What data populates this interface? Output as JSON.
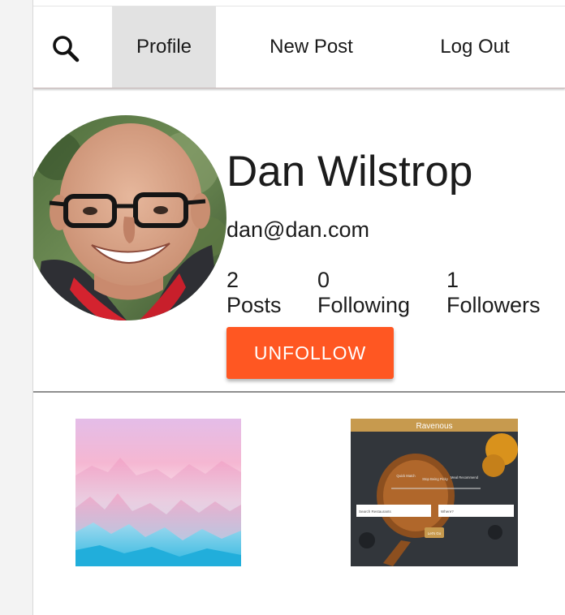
{
  "nav": {
    "search_icon": "search-icon",
    "items": [
      {
        "label": "Profile",
        "active": true
      },
      {
        "label": "New Post",
        "active": false
      },
      {
        "label": "Log Out",
        "active": false
      }
    ]
  },
  "profile": {
    "name": "Dan Wilstrop",
    "email": "dan@dan.com",
    "stats": [
      {
        "count": "2",
        "label": "Posts"
      },
      {
        "count": "0",
        "label": "Following"
      },
      {
        "count": "1",
        "label": "Followers"
      }
    ],
    "action_label": "UNFOLLOW"
  },
  "posts": [
    {
      "title": ""
    },
    {
      "title": "Ravenous",
      "screen_labels": [
        "Quick Match",
        "Stop Being Picky",
        "Meal Recommend"
      ],
      "input_1": "Search Restaurants",
      "input_2": "Where?",
      "button": "Let's Go"
    }
  ],
  "colors": {
    "accent": "#ff5722",
    "nav_active_bg": "#e2e2e2"
  }
}
